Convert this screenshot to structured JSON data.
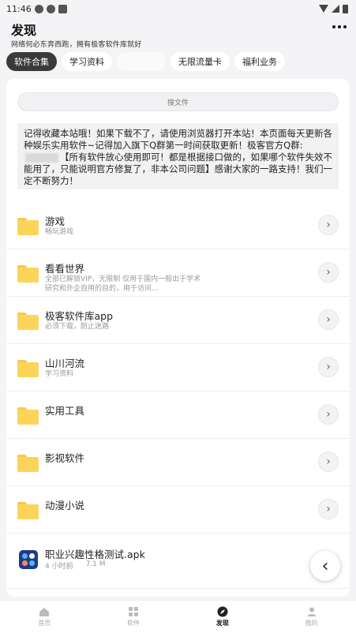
{
  "status_bar": {
    "time": "11:46"
  },
  "header": {
    "title": "发现",
    "subtitle": "网络何必东奔西跑，拥有极客软件库就好"
  },
  "tabs": [
    {
      "label": "软件合集",
      "active": true
    },
    {
      "label": "学习资料",
      "active": false
    },
    {
      "label": "",
      "active": false
    },
    {
      "label": "无限流量卡",
      "active": false
    },
    {
      "label": "福利业务",
      "active": false
    }
  ],
  "search": {
    "placeholder": "搜文件"
  },
  "notice": {
    "text_before": "记得收藏本站哦！如果下载不了，请使用浏览器打开本站！本页面每天更新各种娱乐实用软件~记得加入旗下Q群第一时间获取更新！极客官方Q群:",
    "text_after": "【所有软件放心使用即可！都是根据接口做的，如果哪个软件失效不能用了，只能说明官方修复了，非本公司问题】感谢大家的一路支持！我们一定不断努力！"
  },
  "folders": [
    {
      "title": "游戏",
      "subtitle": "畅玩游戏"
    },
    {
      "title": "看看世界",
      "subtitle": "全部已解锁VIP，无限制 仅用于国内一般出于学术研究和外企自用的目的，用于访问..."
    },
    {
      "title": "极客软件库app",
      "subtitle": "必须下载，防止迷路"
    },
    {
      "title": "山川河流",
      "subtitle": "学习资料"
    },
    {
      "title": "实用工具",
      "subtitle": ""
    },
    {
      "title": "影视软件",
      "subtitle": ""
    },
    {
      "title": "动漫小说",
      "subtitle": ""
    }
  ],
  "file": {
    "title": "职业兴趣性格测试.apk",
    "time": "4 小时前",
    "size": "7.1 M"
  },
  "bottom_nav": [
    {
      "label": "首页",
      "icon": "home-icon",
      "active": false
    },
    {
      "label": "软件",
      "icon": "grid-icon",
      "active": false
    },
    {
      "label": "发现",
      "icon": "compass-icon",
      "active": true
    },
    {
      "label": "我的",
      "icon": "user-icon",
      "active": false
    }
  ],
  "colors": {
    "folder": "#fcd45a",
    "active_tab": "#3a3a3a"
  }
}
